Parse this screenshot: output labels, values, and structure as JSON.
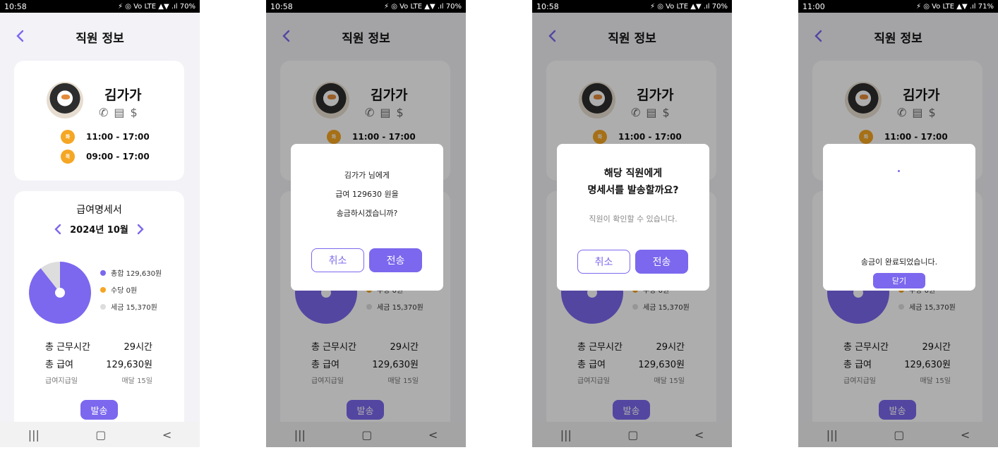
{
  "status": {
    "time_a": "10:58",
    "time_b": "11:00",
    "battery_a": "70%",
    "battery_b": "71%",
    "signals": "⚡ ◎ Vo LTE ▲▼ .ıl"
  },
  "header": {
    "title": "직원 정보"
  },
  "employee": {
    "name": "김가가",
    "contact_icons": [
      "phone-icon",
      "message-icon",
      "dollar-icon"
    ],
    "schedule": [
      {
        "day": "화",
        "hours": "11:00 - 17:00"
      },
      {
        "day": "목",
        "hours": "09:00 - 17:00"
      }
    ]
  },
  "payslip": {
    "title": "급여명세서",
    "month": "2024년 10월",
    "legend": [
      {
        "label": "총합 129,630원",
        "color": "#7b68ee"
      },
      {
        "label": "수당 0원",
        "color": "#f5a623"
      },
      {
        "label": "세금 15,370원",
        "color": "#dddddd"
      }
    ],
    "rows": [
      {
        "label": "총 근무시간",
        "value": "29시간"
      },
      {
        "label": "총 급여",
        "value": "129,630원"
      },
      {
        "label": "급여지급일",
        "value": "매달 15일"
      }
    ],
    "send_label": "발송"
  },
  "chart_data": {
    "type": "pie",
    "categories": [
      "총합",
      "수당",
      "세금"
    ],
    "values": [
      129630,
      0,
      15370
    ],
    "colors": [
      "#7b68ee",
      "#f5a623",
      "#dddddd"
    ]
  },
  "modal_confirm": {
    "line1": "김가가 님에게",
    "line2": "급여 129630 원을",
    "line3": "송금하시겠습니까?",
    "cancel": "취소",
    "send": "전송"
  },
  "modal_statement": {
    "title1": "해당 직원에게",
    "title2": "명세서를 발송할까요?",
    "sub": "직원이 확인할 수 있습니다.",
    "cancel": "취소",
    "send": "전송"
  },
  "modal_done": {
    "message": "송금이 완료되었습니다.",
    "close": "닫기"
  },
  "navbar": {
    "recent": "|||",
    "home": "▢",
    "back": "<"
  }
}
